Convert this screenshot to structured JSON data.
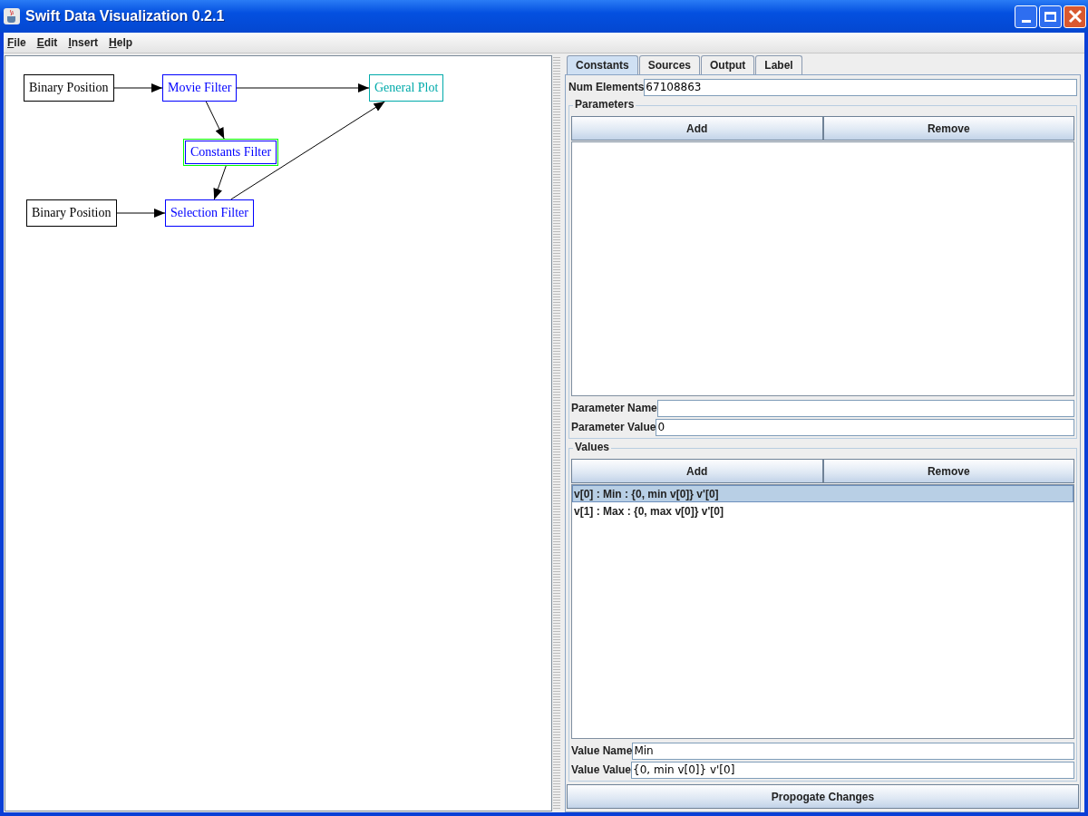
{
  "window": {
    "title": "Swift Data Visualization 0.2.1"
  },
  "menu": [
    {
      "label": "File"
    },
    {
      "label": "Edit"
    },
    {
      "label": "Insert"
    },
    {
      "label": "Help"
    }
  ],
  "graph": {
    "nodes": [
      {
        "label": "Binary Position",
        "color": "#000000",
        "selected": false
      },
      {
        "label": "Movie Filter",
        "color": "#0000ff",
        "selected": false
      },
      {
        "label": "General Plot",
        "color": "#00aaaa",
        "selected": false
      },
      {
        "label": "Constants Filter",
        "color": "#0000ff",
        "selected": true
      },
      {
        "label": "Binary Position",
        "color": "#000000",
        "selected": false
      },
      {
        "label": "Selection Filter",
        "color": "#0000ff",
        "selected": false
      }
    ]
  },
  "tabs": [
    {
      "label": "Constants",
      "selected": true
    },
    {
      "label": "Sources",
      "selected": false
    },
    {
      "label": "Output",
      "selected": false
    },
    {
      "label": "Label",
      "selected": false
    }
  ],
  "num_elements": {
    "label": "Num Elements",
    "value": "67108863"
  },
  "parameters": {
    "title": "Parameters",
    "buttons": [
      "Add",
      "Remove"
    ],
    "fields": [
      {
        "label": "Parameter Name"
      },
      {
        "label": "Parameter Value",
        "value": "0"
      }
    ]
  },
  "values": {
    "title": "Values",
    "buttons": [
      "Add",
      "Remove"
    ],
    "items": [
      {
        "text": "v[0] : Min : {0, min v[0]} v'[0]",
        "selected": true
      },
      {
        "text": "v[1] : Max : {0, max v[0]} v'[0]",
        "selected": false
      }
    ],
    "fields": [
      {
        "label": "Value Name",
        "value": "Min"
      },
      {
        "label": "Value Value",
        "value": "{0, min v[0]} v'[0]"
      }
    ]
  },
  "propagate_button": "Propogate Changes"
}
